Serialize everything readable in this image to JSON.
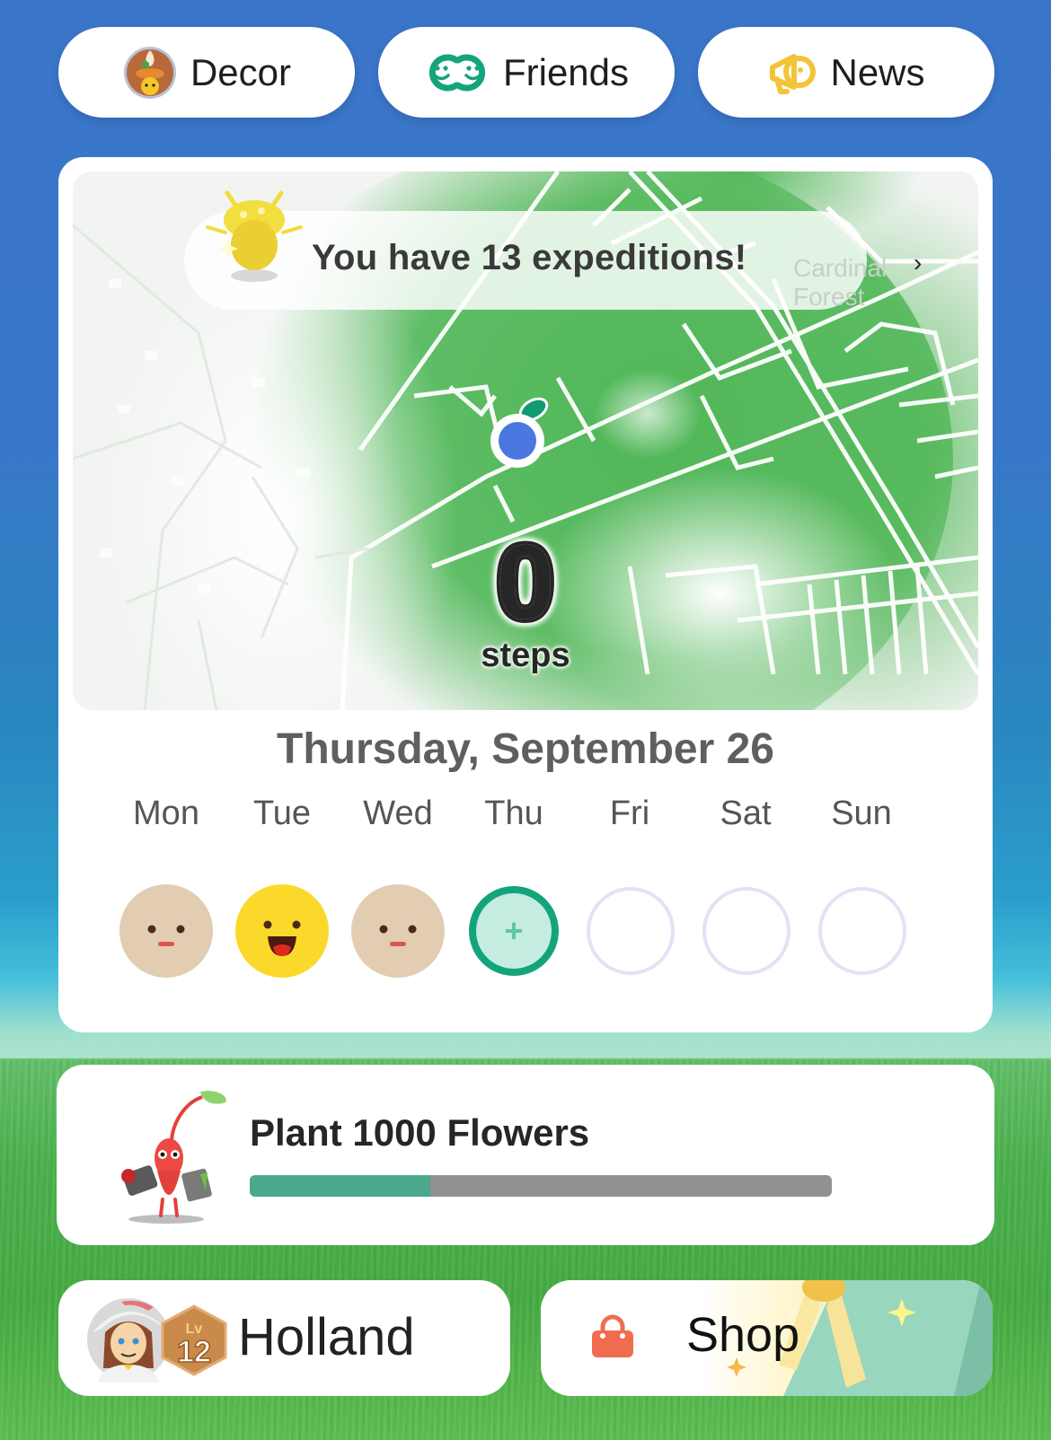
{
  "top_nav": {
    "decor": {
      "label": "Decor",
      "icon": "decor-badge-icon"
    },
    "friends": {
      "label": "Friends",
      "icon": "friends-icon"
    },
    "news": {
      "label": "News",
      "icon": "megaphone-icon"
    }
  },
  "map": {
    "expedition_text": "You have 13 expeditions!",
    "area_name": "Cardinal Forest",
    "chevron": "›",
    "step_count": "0",
    "steps_label": "steps"
  },
  "calendar": {
    "date_title": "Thursday, September 26",
    "days": [
      {
        "label": "Mon",
        "state": "neutral-face"
      },
      {
        "label": "Tue",
        "state": "happy-face"
      },
      {
        "label": "Wed",
        "state": "neutral-face"
      },
      {
        "label": "Thu",
        "state": "add-today"
      },
      {
        "label": "Fri",
        "state": "empty"
      },
      {
        "label": "Sat",
        "state": "empty"
      },
      {
        "label": "Sun",
        "state": "empty"
      }
    ],
    "add_symbol": "+"
  },
  "mission": {
    "title": "Plant 1000 Flowers",
    "progress_percent": 31
  },
  "profile": {
    "name": "Holland",
    "level_prefix": "Lv",
    "level": "12"
  },
  "shop": {
    "label": "Shop"
  },
  "colors": {
    "accent_green": "#14a47c",
    "progress_fill": "#4aa88d",
    "progress_track": "#919191",
    "player_dot": "#4a78e0",
    "shop_icon": "#f06d4f",
    "news_icon": "#f3c43a",
    "level_badge": "#c98a4b"
  }
}
